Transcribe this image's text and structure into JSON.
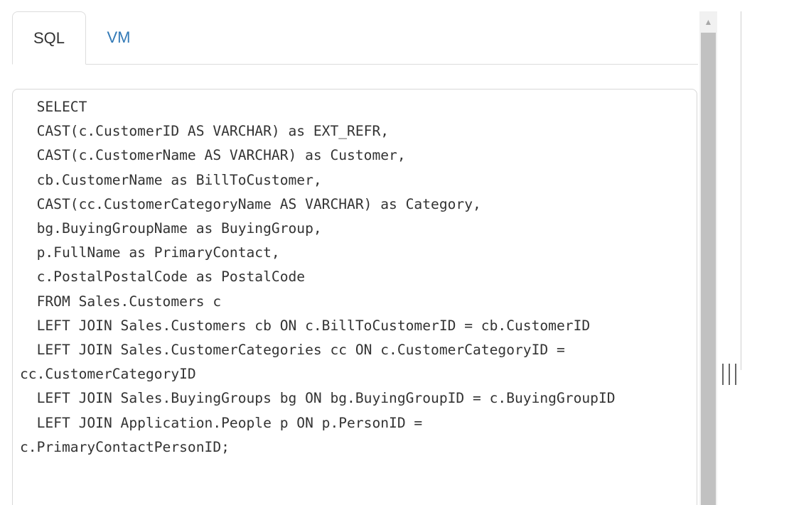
{
  "tabs": [
    {
      "label": "SQL",
      "active": true
    },
    {
      "label": "VM",
      "active": false
    }
  ],
  "editor": {
    "code_lines": [
      "  SELECT",
      "  CAST(c.CustomerID AS VARCHAR) as EXT_REFR,",
      "  CAST(c.CustomerName AS VARCHAR) as Customer,",
      "  cb.CustomerName as BillToCustomer,",
      "  CAST(cc.CustomerCategoryName AS VARCHAR) as Category,",
      "  bg.BuyingGroupName as BuyingGroup,",
      "  p.FullName as PrimaryContact,",
      "  c.PostalPostalCode as PostalCode",
      "  FROM Sales.Customers c",
      "  LEFT JOIN Sales.Customers cb ON c.BillToCustomerID = cb.CustomerID",
      "  LEFT JOIN Sales.CustomerCategories cc ON c.CustomerCategoryID =",
      "cc.CustomerCategoryID",
      "  LEFT JOIN Sales.BuyingGroups bg ON bg.BuyingGroupID = c.BuyingGroupID",
      "  LEFT JOIN Application.People p ON p.PersonID =",
      "c.PrimaryContactPersonID;"
    ]
  },
  "colors": {
    "tab_active_text": "#333333",
    "tab_link_text": "#337ab7",
    "code_text": "#333333",
    "scroll_thumb": "#c1c1c1"
  },
  "icons": {
    "scroll_up": "triangle-up",
    "splitter": "vertical-grip"
  }
}
